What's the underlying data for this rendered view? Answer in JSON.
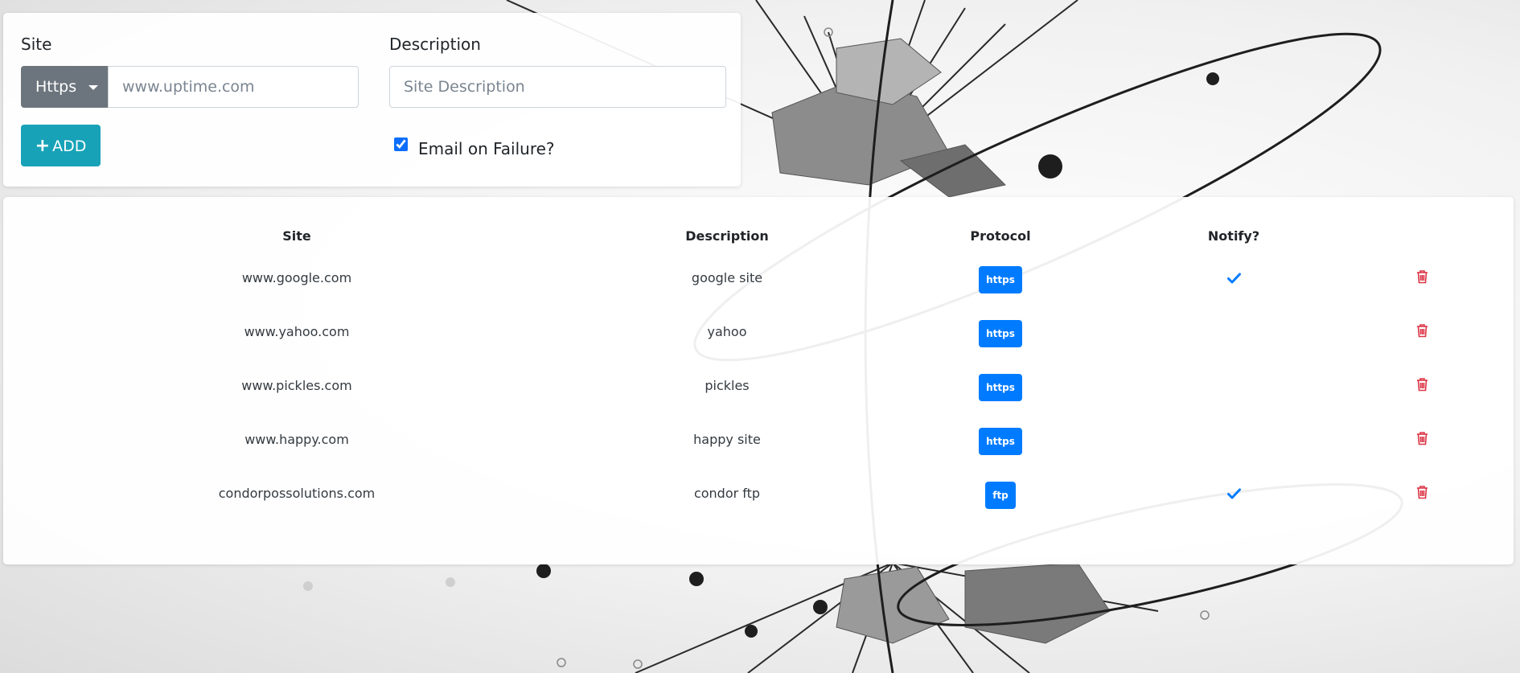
{
  "form": {
    "site_label": "Site",
    "protocol_button": "Https",
    "site_placeholder": "www.uptime.com",
    "description_label": "Description",
    "description_placeholder": "Site Description",
    "email_checkbox_checked": true,
    "email_checkbox_label": "Email on Failure?",
    "add_button_label": "ADD"
  },
  "table": {
    "headers": {
      "site": "Site",
      "description": "Description",
      "protocol": "Protocol",
      "notify": "Notify?"
    },
    "rows": [
      {
        "site": "www.google.com",
        "description": "google site",
        "protocol": "https",
        "notify": true
      },
      {
        "site": "www.yahoo.com",
        "description": "yahoo",
        "protocol": "https",
        "notify": false
      },
      {
        "site": "www.pickles.com",
        "description": "pickles",
        "protocol": "https",
        "notify": false
      },
      {
        "site": "www.happy.com",
        "description": "happy site",
        "protocol": "https",
        "notify": false
      },
      {
        "site": "condorpossolutions.com",
        "description": "condor ftp",
        "protocol": "ftp",
        "notify": true
      }
    ]
  },
  "colors": {
    "primary": "#007bff",
    "info": "#17a2b8",
    "secondary": "#6c757d",
    "danger": "#dc3545"
  },
  "icons": {
    "caret": "caret-down-icon",
    "add": "plus-icon",
    "notify": "check-icon",
    "delete": "trash-icon"
  }
}
